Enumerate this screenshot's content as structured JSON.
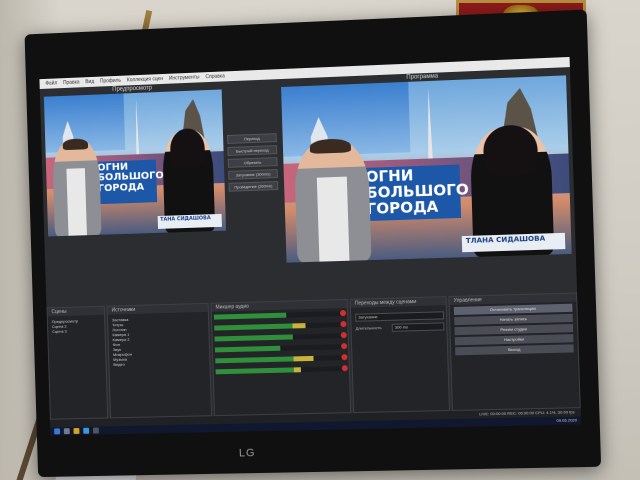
{
  "window": {
    "menu": [
      "Файл",
      "Правка",
      "Вид",
      "Профиль",
      "Коллекция сцен",
      "Инструменты",
      "Справка"
    ],
    "preview_label": "Предпросмотр",
    "program_label": "Программа"
  },
  "video": {
    "title_small": "ОГНИ\nБОЛЬШОГО\nГОРОДА",
    "title_large": "ОГНИ\nБОЛЬШОГО\nГОРОДА",
    "lower_third_small": "ТАНА СИДАШОВА",
    "lower_third_large": "ТЛАНА СИДАШОВА"
  },
  "transitions": {
    "buttons": [
      "Переход",
      "Быстрый переход",
      "Обрезать",
      "Затухание (300ms)",
      "Проведение (300ms)"
    ]
  },
  "docks": {
    "scenes_header": "Сцены",
    "scenes": [
      "Предпросмотр",
      "Сцена 2",
      "Сцена 3"
    ],
    "sources_header": "Источники",
    "sources": [
      "Заставка",
      "Титры",
      "Логотип",
      "Камера 1",
      "Камера 2",
      "Фон",
      "Звук",
      "Микрофон",
      "Музыка",
      "Видео"
    ],
    "mixer_header": "Микшер аудио",
    "mixer_levels": [
      0.55,
      0.7,
      0.6,
      0.5,
      0.75,
      0.65
    ],
    "transitions_header": "Переходы между сценами",
    "transition_value": "Затухание",
    "duration_label": "Длительность",
    "duration_value": "300 ms",
    "controls_header": "Управление",
    "controls": [
      "Остановить трансляцию",
      "Начать запись",
      "Режим студии",
      "Настройки",
      "Выход"
    ]
  },
  "status": {
    "text": "LIVE: 00:00:00  REC: 00:00:00  CPU: 4.1%, 30.00 fps"
  },
  "taskbar": {
    "clock": "09.06.2020"
  },
  "tv": {
    "brand": "LG"
  },
  "colors": {
    "screen_bg": "#2b2d31",
    "accent_blue": "#1d57a8",
    "mute_red": "#d03030"
  }
}
